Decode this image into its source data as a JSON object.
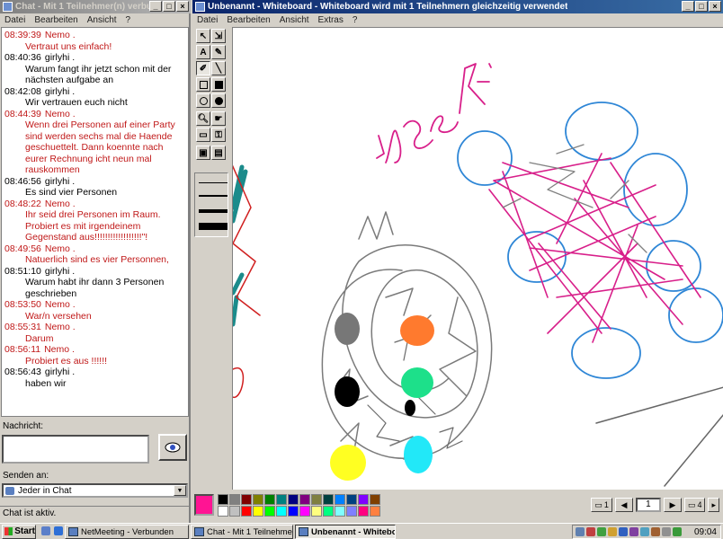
{
  "chat_window": {
    "title": "Chat - Mit 1 Teilnehmer(n) verbu...",
    "menu": [
      "Datei",
      "Bearbeiten",
      "Ansicht",
      "?"
    ],
    "messages": [
      {
        "time": "08:39:39",
        "sender": "Nemo .",
        "text": "Vertraut uns einfach!",
        "color": "red"
      },
      {
        "time": "08:40:36",
        "sender": "girlyhi .",
        "text": "Warum fangt ihr jetzt schon mit der nächsten aufgabe an",
        "color": "black"
      },
      {
        "time": "08:42:08",
        "sender": "girlyhi .",
        "text": "Wir vertrauen euch nicht",
        "color": "black"
      },
      {
        "time": "08:44:39",
        "sender": "Nemo .",
        "text": "Wenn drei Personen auf einer Party sind werden sechs mal die Haende geschuettelt.  Dann koennte nach eurer Rechnung icht neun mal rauskommen",
        "color": "red"
      },
      {
        "time": "08:46:56",
        "sender": "girlyhi .",
        "text": "Es sind vier Personen",
        "color": "black"
      },
      {
        "time": "08:48:22",
        "sender": "Nemo .",
        "text": "Ihr seid drei Personen im Raum. Probiert es mit irgendeinem Gegenstand aus!!!!!!!!!!!!!!!!!!\"!",
        "color": "red"
      },
      {
        "time": "08:49:56",
        "sender": "Nemo .",
        "text": "Natuerlich sind es vier Personnen,",
        "color": "red"
      },
      {
        "time": "08:51:10",
        "sender": "girlyhi .",
        "text": "Warum habt ihr dann 3 Personen geschrieben",
        "color": "black"
      },
      {
        "time": "08:53:50",
        "sender": "Nemo .",
        "text": "War/n versehen",
        "color": "red"
      },
      {
        "time": "08:55:31",
        "sender": "Nemo .",
        "text": "Darum",
        "color": "red"
      },
      {
        "time": "08:56:11",
        "sender": "Nemo .",
        "text": "Probiert es aus !!!!!!",
        "color": "red"
      },
      {
        "time": "08:56:43",
        "sender": "girlyhi .",
        "text": "haben wir",
        "color": "black"
      }
    ],
    "message_label": "Nachricht:",
    "message_value": "",
    "send_to_label": "Senden an:",
    "recipient": "Jeder in Chat",
    "status": "Chat ist aktiv."
  },
  "whiteboard": {
    "title": "Unbenannt - Whiteboard - Whiteboard wird mit 1 Teilnehmern gleichzeitig verwendet",
    "menu": [
      "Datei",
      "Bearbeiten",
      "Ansicht",
      "Extras",
      "?"
    ],
    "tools": [
      "select-tool",
      "zoom-select-tool",
      "text-tool",
      "highlighter-tool",
      "pen-tool",
      "line-tool",
      "unfilled-rectangle-tool",
      "filled-rectangle-tool",
      "unfilled-ellipse-tool",
      "filled-ellipse-tool",
      "zoom-tool",
      "remote-pointer-tool",
      "eraser-tool",
      "lock-contents-tool",
      "select-area-tool",
      "select-window-tool"
    ],
    "canvas_text": {
      "written_word": "15 me",
      "formula": "x=4"
    },
    "active_color": "#ff1493",
    "palette": [
      "#000000",
      "#808080",
      "#800000",
      "#808000",
      "#008000",
      "#008080",
      "#000080",
      "#800080",
      "#808040",
      "#004040",
      "#0080ff",
      "#004080",
      "#8000ff",
      "#804000",
      "#ffffff",
      "#c0c0c0",
      "#ff0000",
      "#ffff00",
      "#00ff00",
      "#00ffff",
      "#0000ff",
      "#ff00ff",
      "#ffff80",
      "#00ff80",
      "#80ffff",
      "#8080ff",
      "#ff0080",
      "#ff8040"
    ],
    "page_nav": {
      "first": "1",
      "current": "1",
      "last": "4"
    }
  },
  "taskbar": {
    "start": "Start",
    "tasks": [
      "NetMeeting - Verbunden",
      "Chat - Mit 1 Teilnehmer(...",
      "Unbenannt - Whitebo..."
    ],
    "clock": "09:04"
  }
}
